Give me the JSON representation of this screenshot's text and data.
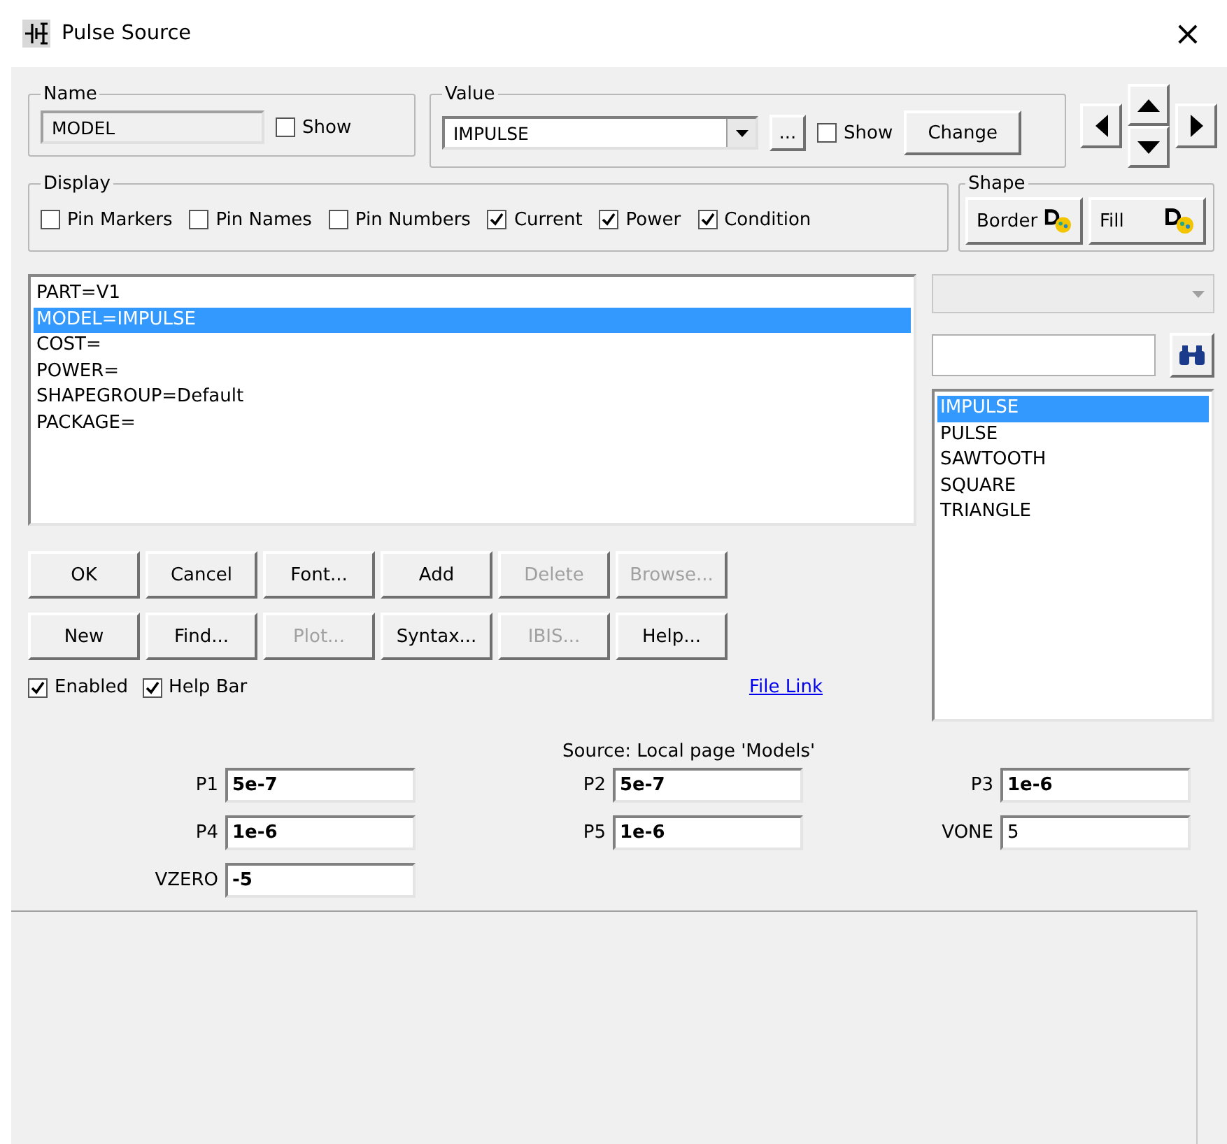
{
  "window": {
    "title": "Pulse Source",
    "close": "×"
  },
  "name_group": {
    "label": "Name",
    "value": "MODEL",
    "show": {
      "label": "Show",
      "checked": false
    }
  },
  "value_group": {
    "label": "Value",
    "value": "IMPULSE",
    "more": "...",
    "show": {
      "label": "Show",
      "checked": false
    },
    "change": "Change"
  },
  "display": {
    "label": "Display",
    "options": [
      {
        "label": "Pin Markers",
        "checked": false
      },
      {
        "label": "Pin Names",
        "checked": false
      },
      {
        "label": "Pin Numbers",
        "checked": false
      },
      {
        "label": "Current",
        "checked": true
      },
      {
        "label": "Power",
        "checked": true
      },
      {
        "label": "Condition",
        "checked": true
      }
    ]
  },
  "shape": {
    "label": "Shape",
    "buttons": [
      "Border",
      "Fill"
    ]
  },
  "attributes": [
    {
      "text": "PART=V1",
      "selected": false
    },
    {
      "text": "MODEL=IMPULSE",
      "selected": true
    },
    {
      "text": "COST=",
      "selected": false
    },
    {
      "text": "POWER=",
      "selected": false
    },
    {
      "text": "SHAPEGROUP=Default",
      "selected": false
    },
    {
      "text": "PACKAGE=",
      "selected": false
    }
  ],
  "button_rows": [
    [
      {
        "label": "OK",
        "disabled": false
      },
      {
        "label": "Cancel",
        "disabled": false
      },
      {
        "label": "Font...",
        "disabled": false
      },
      {
        "label": "Add",
        "disabled": false
      },
      {
        "label": "Delete",
        "disabled": true
      },
      {
        "label": "Browse...",
        "disabled": true
      }
    ],
    [
      {
        "label": "New",
        "disabled": false
      },
      {
        "label": "Find...",
        "disabled": false
      },
      {
        "label": "Plot...",
        "disabled": true
      },
      {
        "label": "Syntax...",
        "disabled": false
      },
      {
        "label": "IBIS...",
        "disabled": true
      },
      {
        "label": "Help...",
        "disabled": false
      }
    ]
  ],
  "options": [
    {
      "label": "Enabled",
      "checked": true
    },
    {
      "label": "Help Bar",
      "checked": true
    }
  ],
  "file_link": "File Link",
  "models": [
    {
      "text": "IMPULSE",
      "selected": true
    },
    {
      "text": "PULSE",
      "selected": false
    },
    {
      "text": "SAWTOOTH",
      "selected": false
    },
    {
      "text": "SQUARE",
      "selected": false
    },
    {
      "text": "TRIANGLE",
      "selected": false
    }
  ],
  "source": "Source: Local page 'Models'",
  "parameters": [
    {
      "label": "P1",
      "value": "5e-7",
      "bold": true
    },
    {
      "label": "P2",
      "value": "5e-7",
      "bold": true
    },
    {
      "label": "P3",
      "value": "1e-6",
      "bold": true
    },
    {
      "label": "P4",
      "value": "1e-6",
      "bold": true
    },
    {
      "label": "P5",
      "value": "1e-6",
      "bold": true
    },
    {
      "label": "VONE",
      "value": "5",
      "bold": false
    },
    {
      "label": "VZERO",
      "value": "-5",
      "bold": true
    }
  ]
}
